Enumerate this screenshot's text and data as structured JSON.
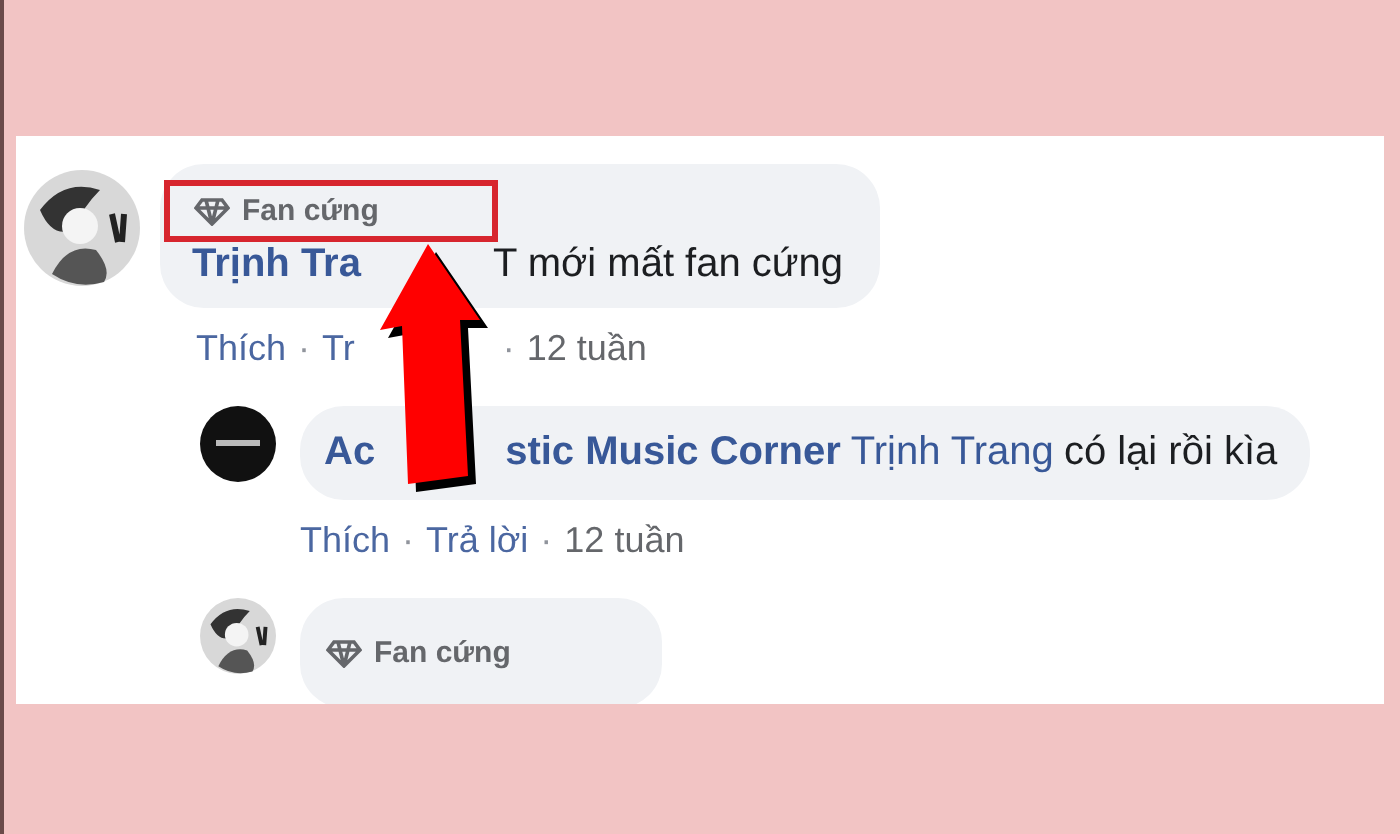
{
  "comments": [
    {
      "kind": "figure",
      "badge": {
        "label": "Fan cứng",
        "highlighted": true
      },
      "line": [
        {
          "kind": "author",
          "text": "Trịnh Tra"
        },
        {
          "kind": "covered"
        },
        {
          "kind": "text",
          "text": "T mới mất fan cứng"
        }
      ],
      "meta": [
        {
          "kind": "link",
          "text": "Thích"
        },
        {
          "kind": "sep",
          "text": "·"
        },
        {
          "kind": "link",
          "text": "Tr"
        },
        {
          "kind": "covered"
        },
        {
          "kind": "sep",
          "text": "·"
        },
        {
          "kind": "time",
          "text": "12 tuần"
        }
      ],
      "children": [
        {
          "kind": "logo",
          "line": [
            {
              "kind": "author",
              "text": "Ac"
            },
            {
              "kind": "covered"
            },
            {
              "kind": "author",
              "text": "stic Music Corner"
            },
            {
              "kind": "mention",
              "text": "Trịnh Trang"
            },
            {
              "kind": "text",
              "text": "có lại rồi kìa"
            }
          ],
          "meta": [
            {
              "kind": "link",
              "text": "Thích"
            },
            {
              "kind": "sep",
              "text": "·"
            },
            {
              "kind": "link",
              "text": "Trả lời"
            },
            {
              "kind": "sep",
              "text": "·"
            },
            {
              "kind": "time",
              "text": "12 tuần"
            }
          ]
        },
        {
          "kind": "figure",
          "badge": {
            "label": "Fan cứng",
            "highlighted": false
          }
        }
      ]
    }
  ],
  "annotation": {
    "kind": "arrow"
  }
}
